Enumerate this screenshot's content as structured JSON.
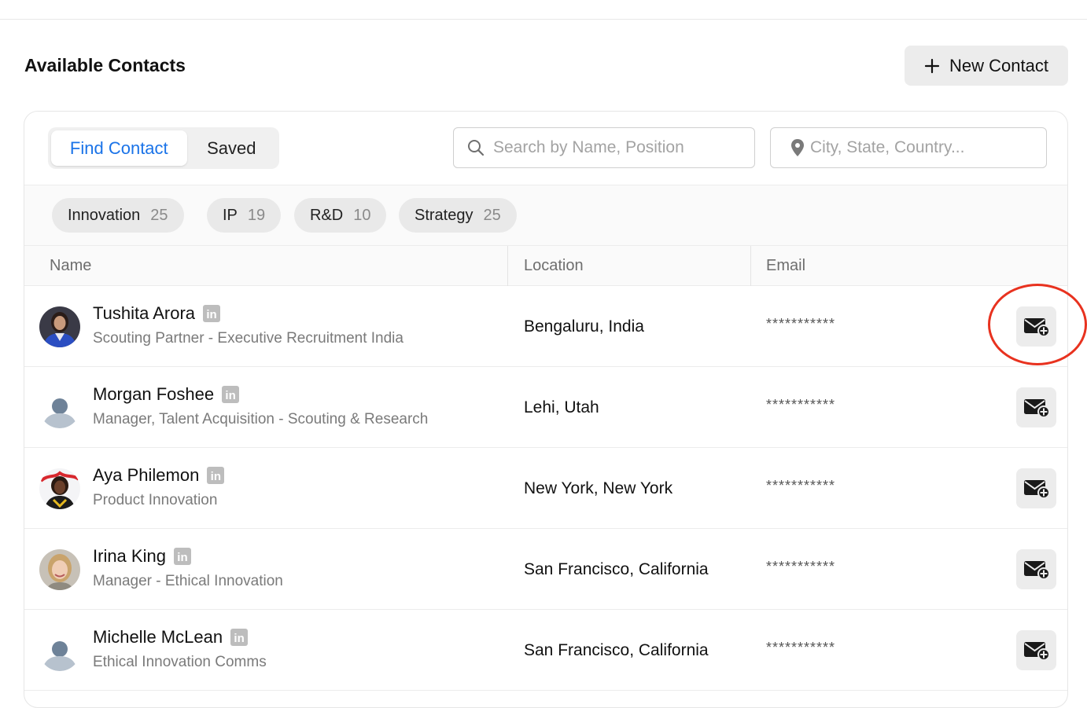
{
  "header": {
    "title": "Available Contacts",
    "new_contact_label": "New Contact"
  },
  "toggle": {
    "find_label": "Find Contact",
    "saved_label": "Saved",
    "active": "Find Contact"
  },
  "search": {
    "name_placeholder": "Search by Name, Position",
    "location_placeholder": "City, State, Country..."
  },
  "filters": [
    {
      "label": "Innovation",
      "count": "25"
    },
    {
      "label": "IP",
      "count": "19"
    },
    {
      "label": "R&D",
      "count": "10"
    },
    {
      "label": "Strategy",
      "count": "25"
    }
  ],
  "table": {
    "columns": [
      "Name",
      "Location",
      "Email"
    ],
    "rows": [
      {
        "name": "Tushita Arora",
        "title": "Scouting Partner - Executive Recruitment India",
        "location": "Bengaluru, India",
        "email": "***********",
        "avatar": "photo"
      },
      {
        "name": "Morgan Foshee",
        "title": "Manager, Talent Acquisition - Scouting & Research",
        "location": "Lehi, Utah",
        "email": "***********",
        "avatar": "placeholder"
      },
      {
        "name": "Aya Philemon",
        "title": "Product Innovation",
        "location": "New York, New York",
        "email": "***********",
        "avatar": "photo"
      },
      {
        "name": "Irina King",
        "title": "Manager - Ethical Innovation",
        "location": "San Francisco, California",
        "email": "***********",
        "avatar": "photo"
      },
      {
        "name": "Michelle McLean",
        "title": "Ethical Innovation Comms",
        "location": "San Francisco, California",
        "email": "***********",
        "avatar": "placeholder"
      }
    ]
  },
  "icons": {
    "plus": "plus-icon",
    "search": "search-icon",
    "location": "location-pin-icon",
    "linkedin": "linkedin-icon",
    "add_email": "mail-plus-icon"
  },
  "colors": {
    "accent": "#1a73e8",
    "annotation": "#e8321f",
    "button_bg": "#ececec"
  }
}
